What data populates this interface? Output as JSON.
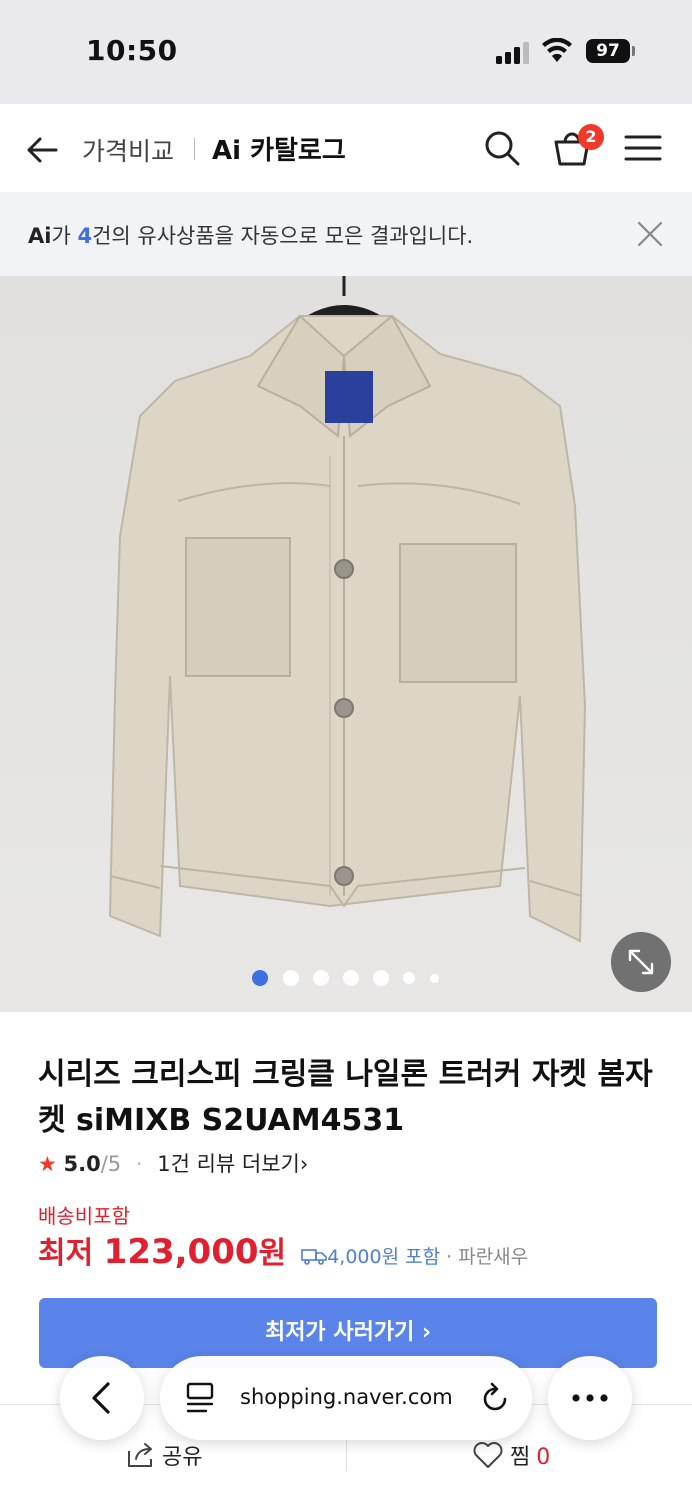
{
  "status_bar": {
    "time": "10:50",
    "battery": "97"
  },
  "header": {
    "title_left": "가격비교",
    "title_right": "Ai 카탈로그",
    "cart_count": "2"
  },
  "ai_banner": {
    "ai_logo": "Ai",
    "prefix": "가 ",
    "count": "4",
    "suffix": "건의 유사상품을 자동으로 모은 결과입니다."
  },
  "gallery": {
    "total_dots": 7,
    "active_index": 0
  },
  "product": {
    "title": "시리즈 크리스피 크링클 나일론 트러커 자켓 봄자켓 siMIXB S2UAM4531",
    "star": "★",
    "rating": "5.0",
    "rating_max": "/5",
    "sep": "·",
    "review": "1건 리뷰 더보기",
    "review_chevron": "›",
    "shipping_label": "배송비포함",
    "price_prefix": "최저 ",
    "price": "123,000",
    "price_unit": "원",
    "shipping_fee": "4,000원 포함",
    "seller_sep": " · ",
    "seller": "파란새우",
    "buy_button": "최저가 사러가기 ›"
  },
  "bottom_bar": {
    "share": "공유",
    "zzim": "찜",
    "zzim_count": "0"
  },
  "browser": {
    "url": "shopping.naver.com"
  },
  "colors": {
    "accent_blue": "#5b84ea",
    "price_red": "#e0202e",
    "badge_red": "#f0392b",
    "banner_bg": "#f1f3f7"
  },
  "icons": [
    "back-arrow-icon",
    "search-icon",
    "cart-icon",
    "menu-icon",
    "close-icon",
    "expand-icon",
    "star-icon",
    "truck-icon",
    "share-icon",
    "heart-icon",
    "reader-icon",
    "reload-icon",
    "more-icon"
  ]
}
